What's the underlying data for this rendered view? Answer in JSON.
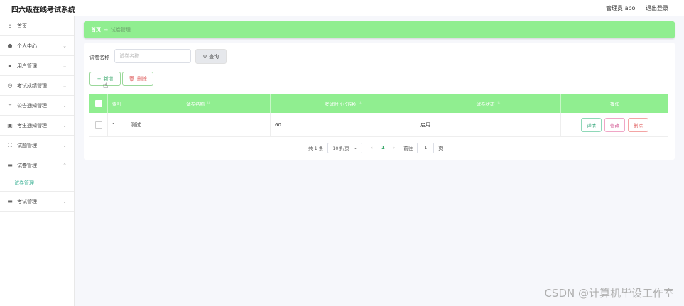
{
  "header": {
    "app_title": "四六级在线考试系统",
    "user_label": "管理员 abo",
    "logout_label": "退出登录"
  },
  "sidebar": {
    "items": [
      {
        "label": "首页",
        "icon": "home-icon",
        "chevron": false
      },
      {
        "label": "个人中心",
        "icon": "user-icon",
        "chevron": true
      },
      {
        "label": "用户管理",
        "icon": "users-icon",
        "chevron": true
      },
      {
        "label": "考试成绩管理",
        "icon": "clock-icon",
        "chevron": true
      },
      {
        "label": "公告通知管理",
        "icon": "crop-icon",
        "chevron": true
      },
      {
        "label": "考生通知管理",
        "icon": "image-icon",
        "chevron": true
      },
      {
        "label": "试题管理",
        "icon": "fullscreen-icon",
        "chevron": true
      },
      {
        "label": "试卷管理",
        "icon": "monitor-icon",
        "chevron": true,
        "expanded": true,
        "sub": "试卷管理"
      },
      {
        "label": "考试管理",
        "icon": "monitor-icon",
        "chevron": true
      }
    ]
  },
  "breadcrumb": {
    "home": "首页",
    "separator": "→",
    "current": "试卷管理"
  },
  "search": {
    "label": "试卷名称",
    "placeholder": "试卷名称",
    "button_label": "查询"
  },
  "actions": {
    "add_label": "新增",
    "delete_label": "删除"
  },
  "table": {
    "headers": [
      "索引",
      "试卷名称",
      "考试时长(分钟)",
      "试卷状态",
      "操作"
    ],
    "rows": [
      {
        "index": "1",
        "name": "测试",
        "duration": "60",
        "status": "启用"
      }
    ],
    "ops": {
      "detail": "详情",
      "edit": "修改",
      "delete": "删除"
    }
  },
  "pagination": {
    "total": "共 1 条",
    "page_size": "10条/页",
    "current_page": "1",
    "goto_label": "前往",
    "goto_value": "1",
    "page_unit": "页"
  },
  "watermark": "CSDN @计算机毕设工作室",
  "colors": {
    "accent": "#90ee90",
    "sidebar_active": "#45b59a"
  }
}
